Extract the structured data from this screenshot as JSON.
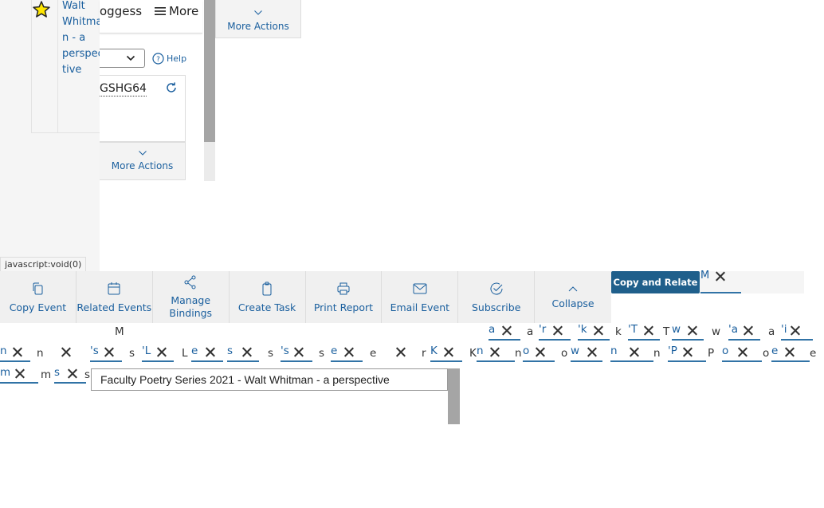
{
  "event_card": {
    "title_lines": [
      "Walt",
      "Whitma",
      "n - a",
      "perspec",
      "tive"
    ],
    "owner_fragment": "oggess",
    "more_label": "More",
    "help_label": "Help",
    "reference_code": "GSHG64",
    "more_actions_label": "More Actions"
  },
  "right_panel": {
    "more_actions_label": "More Actions"
  },
  "status_bar": {
    "text": "javascript:void(0)"
  },
  "toolbar": {
    "buttons": [
      {
        "label": "Copy Event",
        "icon": "copy-icon"
      },
      {
        "label": "Related Events",
        "icon": "calendar-icon"
      },
      {
        "label": "Manage Bindings",
        "icon": "share-icon"
      },
      {
        "label": "Create Task",
        "icon": "clipboard-icon"
      },
      {
        "label": "Print Report",
        "icon": "printer-icon"
      },
      {
        "label": "Email Event",
        "icon": "mail-icon"
      },
      {
        "label": "Subscribe",
        "icon": "check-circle-icon"
      },
      {
        "label": "Collapse",
        "icon": "chevron-up-icon"
      }
    ],
    "copy_relate_label": "Copy and Relate",
    "tag_letter": "M"
  },
  "name_field": {
    "value": "Faculty Poetry Series 2021 - Walt Whitman - a perspective",
    "cursor_letter": "M"
  },
  "colors": {
    "link": "#1a5f9e",
    "primary_button": "#1f5f8b",
    "toolbar_bg": "#f0f0f0"
  }
}
